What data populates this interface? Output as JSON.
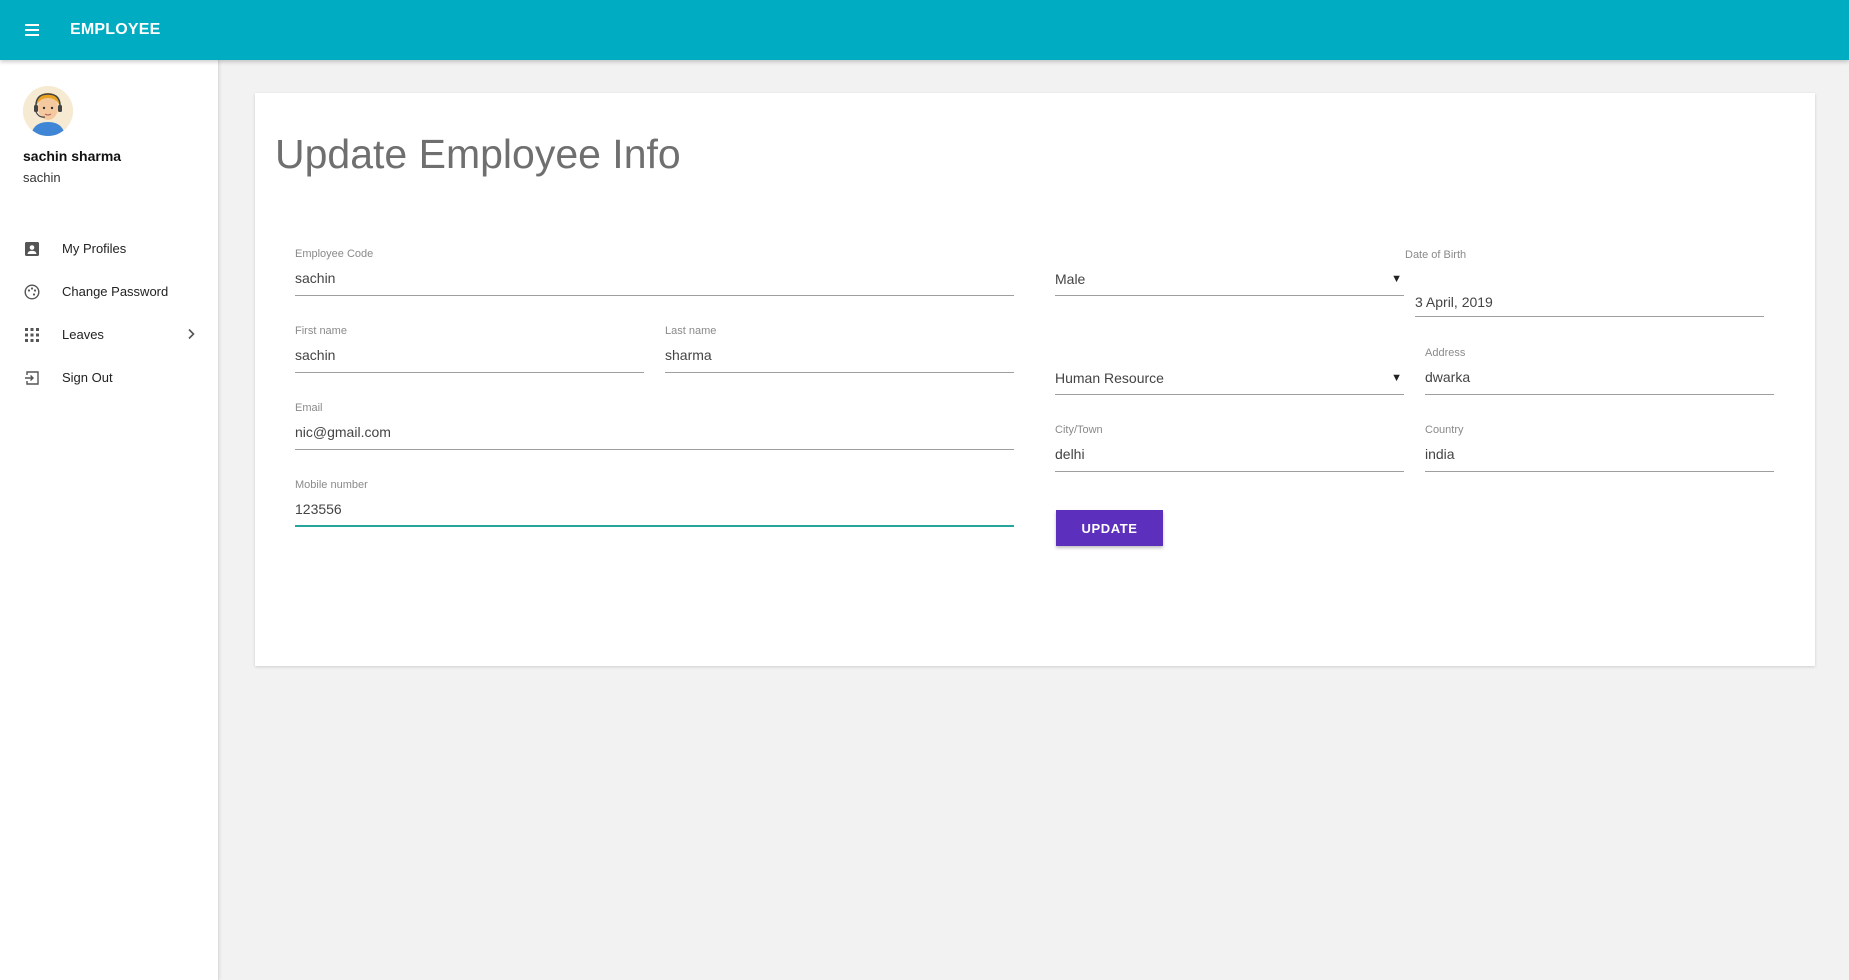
{
  "header": {
    "title": "EMPLOYEE",
    "menu_icon": "hamburger-menu-icon"
  },
  "sidebar": {
    "user": {
      "name": "sachin sharma",
      "username": "sachin",
      "avatar": "avatar-headset-icon"
    },
    "items": [
      {
        "label": "My Profiles",
        "icon": "account-box-icon"
      },
      {
        "label": "Change Password",
        "icon": "palette-icon"
      },
      {
        "label": "Leaves",
        "icon": "apps-grid-icon",
        "has_submenu": true
      },
      {
        "label": "Sign Out",
        "icon": "exit-to-app-icon"
      }
    ]
  },
  "form": {
    "title": "Update Employee Info",
    "employee_code": {
      "label": "Employee Code",
      "value": "sachin"
    },
    "first_name": {
      "label": "First name",
      "value": "sachin"
    },
    "last_name": {
      "label": "Last name",
      "value": "sharma"
    },
    "email": {
      "label": "Email",
      "value": "nic@gmail.com"
    },
    "mobile": {
      "label": "Mobile number",
      "value": "123556"
    },
    "gender": {
      "value": "Male"
    },
    "department": {
      "value": "Human Resource"
    },
    "dob": {
      "label": "Date of Birth",
      "value": "3 April, 2019"
    },
    "address": {
      "label": "Address",
      "value": "dwarka"
    },
    "city": {
      "label": "City/Town",
      "value": "delhi"
    },
    "country": {
      "label": "Country",
      "value": "india"
    },
    "update_label": "UPDATE"
  },
  "colors": {
    "header": "#00acc1",
    "button": "#5c2fbd",
    "focus_line": "#26a69a"
  }
}
